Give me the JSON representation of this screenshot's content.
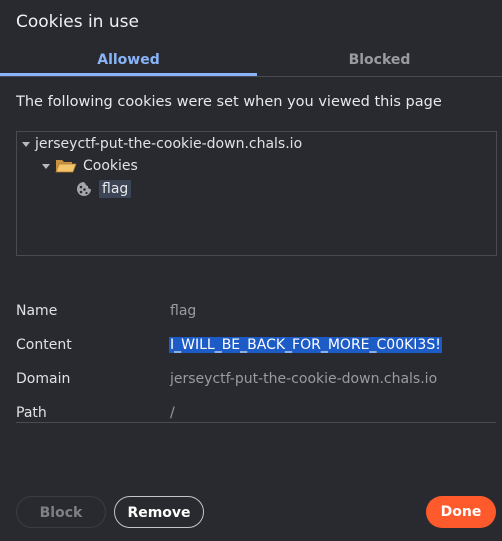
{
  "dialog": {
    "title": "Cookies in use",
    "tabs": [
      {
        "label": "Allowed",
        "active": true
      },
      {
        "label": "Blocked",
        "active": false
      }
    ],
    "subtitle": "The following cookies were set when you viewed this page"
  },
  "tree": {
    "site": "jerseyctf-put-the-cookie-down.chals.io",
    "folder": "Cookies",
    "cookie": "flag",
    "icons": {
      "site_twisty": "triangle-down-icon",
      "folder_twisty": "triangle-down-icon",
      "folder": "folder-open-icon",
      "cookie": "cookie-icon"
    }
  },
  "details": {
    "rows": [
      {
        "label": "Name",
        "value": "flag"
      },
      {
        "label": "Content",
        "value": "I_WILL_BE_BACK_FOR_MORE_C00KI3S!",
        "selected": true
      },
      {
        "label": "Domain",
        "value": "jerseyctf-put-the-cookie-down.chals.io"
      },
      {
        "label": "Path",
        "value": "/"
      }
    ]
  },
  "buttons": {
    "block": "Block",
    "remove": "Remove",
    "done": "Done"
  },
  "colors": {
    "accent": "#8ab4f8",
    "primary_button": "#ff5a2b",
    "selection": "#1d5cc6",
    "background": "#292a2f"
  }
}
